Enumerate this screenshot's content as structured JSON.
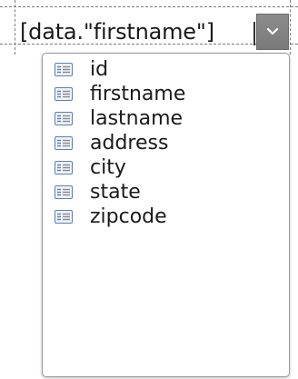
{
  "combo": {
    "value": "[data.\"firstname\"]",
    "button_icon": "chevron-down-icon"
  },
  "dropdown": {
    "item_icon": "table-field-icon",
    "items": [
      {
        "label": "id"
      },
      {
        "label": "firstname"
      },
      {
        "label": "lastname"
      },
      {
        "label": "address"
      },
      {
        "label": "city"
      },
      {
        "label": "state"
      },
      {
        "label": "zipcode"
      }
    ]
  },
  "colors": {
    "combo_button": "#7f7f7f",
    "icon_blue": "#5b7fb8",
    "dropdown_border": "#9a9a9a"
  }
}
